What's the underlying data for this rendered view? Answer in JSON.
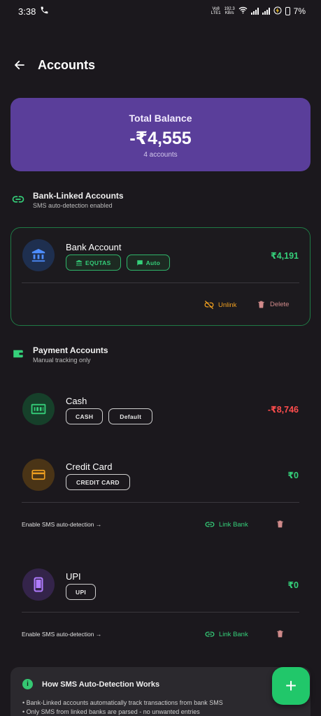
{
  "status_bar": {
    "time": "3:38",
    "network_top": "Vo8",
    "network_bottom": "LTE1",
    "speed_top": "192.3",
    "speed_bottom": "KB/s",
    "battery": "7%"
  },
  "app_bar": {
    "title": "Accounts"
  },
  "balance": {
    "label": "Total Balance",
    "value": "-₹4,555",
    "count": "4 accounts"
  },
  "bank_section": {
    "title": "Bank-Linked Accounts",
    "subtitle": "SMS auto-detection enabled"
  },
  "bank_account": {
    "name": "Bank Account",
    "chip_bank": "EQUTAS",
    "chip_auto": "Auto",
    "amount": "₹4,191",
    "unlink": "Unlink",
    "delete": "Delete"
  },
  "payment_section": {
    "title": "Payment Accounts",
    "subtitle": "Manual tracking only"
  },
  "cash": {
    "name": "Cash",
    "chip_type": "CASH",
    "chip_default": "Default",
    "amount": "-₹8,746"
  },
  "credit_card": {
    "name": "Credit Card",
    "chip_type": "CREDIT CARD",
    "amount": "₹0",
    "sms_hint": "Enable SMS auto-detection →",
    "link_bank": "Link Bank"
  },
  "upi": {
    "name": "UPI",
    "chip_type": "UPI",
    "amount": "₹0",
    "sms_hint": "Enable SMS auto-detection →",
    "link_bank": "Link Bank"
  },
  "info": {
    "title": "How SMS Auto-Detection Works",
    "line1": "• Bank-Linked accounts automatically track transactions from bank SMS",
    "line2": "• Only SMS from linked banks are parsed - no unwanted entries"
  },
  "fab": {
    "label": "+"
  },
  "colors": {
    "background": "#1b181d",
    "balance_card": "#5a3e9a",
    "positive": "#35d07a",
    "negative": "#ff4d4d",
    "unlink": "#f0a020",
    "delete": "#d08a8a",
    "fab": "#21c76a"
  }
}
